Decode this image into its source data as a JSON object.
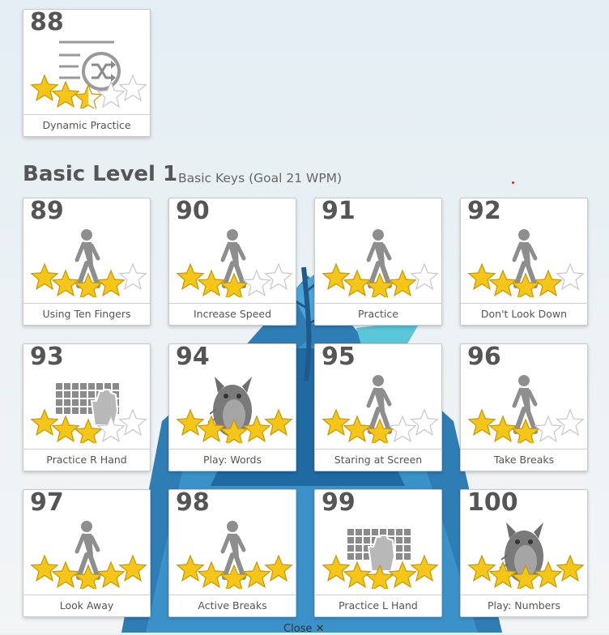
{
  "top_lesson": {
    "number": "88",
    "title": "Dynamic Practice",
    "stars": 2.5,
    "icon": "shuffle-list-icon"
  },
  "section": {
    "title": "Basic Level 1",
    "subtitle": "Basic Keys (Goal 21 WPM)"
  },
  "lessons": [
    {
      "number": "89",
      "title": "Using Ten Fingers",
      "stars": 4,
      "icon": "walking-person-icon"
    },
    {
      "number": "90",
      "title": "Increase Speed",
      "stars": 3,
      "icon": "walking-person-icon"
    },
    {
      "number": "91",
      "title": "Practice",
      "stars": 4,
      "icon": "walking-person-icon"
    },
    {
      "number": "92",
      "title": "Don't Look Down",
      "stars": 4,
      "icon": "walking-person-icon"
    },
    {
      "number": "93",
      "title": "Practice R Hand",
      "stars": 3,
      "icon": "keyboard-right-hand-icon"
    },
    {
      "number": "94",
      "title": "Play: Words",
      "stars": 5,
      "icon": "monster-game-icon"
    },
    {
      "number": "95",
      "title": "Staring at Screen",
      "stars": 3,
      "icon": "walking-person-icon"
    },
    {
      "number": "96",
      "title": "Take Breaks",
      "stars": 3,
      "icon": "walking-person-icon"
    },
    {
      "number": "97",
      "title": "Look Away",
      "stars": 5,
      "icon": "walking-person-icon"
    },
    {
      "number": "98",
      "title": "Active Breaks",
      "stars": 5,
      "icon": "walking-person-icon"
    },
    {
      "number": "99",
      "title": "Practice L Hand",
      "stars": 5,
      "icon": "keyboard-left-hand-icon"
    },
    {
      "number": "100",
      "title": "Play: Numbers",
      "stars": 5,
      "icon": "monster-game-icon"
    }
  ],
  "close_label": "Close",
  "colors": {
    "star_fill": "#f5c518",
    "star_empty": "#ffffff",
    "text": "#555555",
    "icon_gray": "#8a8a8a"
  }
}
